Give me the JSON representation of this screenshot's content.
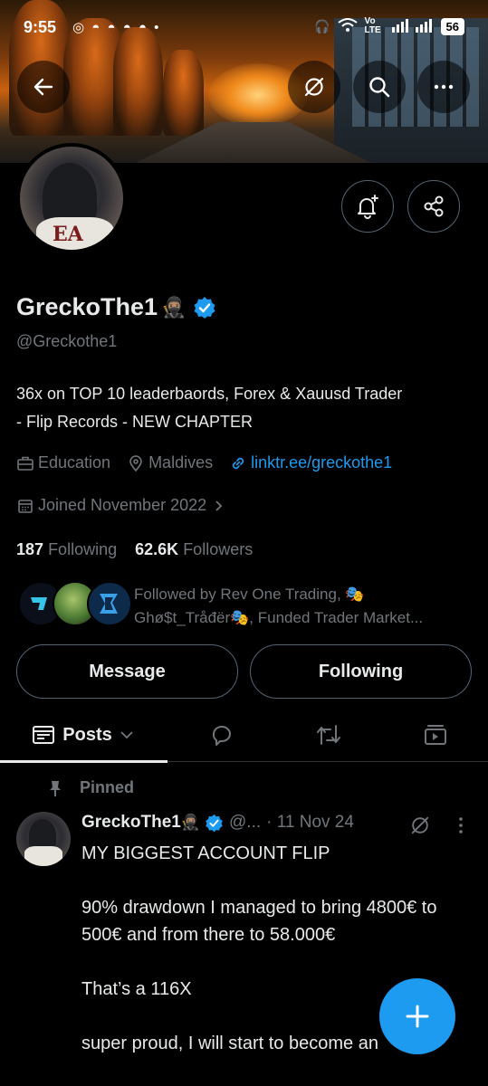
{
  "status_bar": {
    "time": "9:55",
    "network": "Vo LTE",
    "battery": "56"
  },
  "profile": {
    "name": "GreckoThe1",
    "name_emoji": "🥷🏽",
    "handle": "@Greckothe1",
    "bio_line1": "36x on TOP 10 leaderbaords, Forex & Xauusd Trader",
    "bio_line2": "- Flip Records - NEW CHAPTER",
    "category": "Education",
    "location": "Maldives",
    "link": "linktr.ee/greckothe1",
    "joined": "Joined November 2022",
    "following_count": "187",
    "following_label": "Following",
    "followers_count": "62.6K",
    "followers_label": "Followers",
    "followed_by_line1": "Followed by Rev One Trading, 🎭",
    "followed_by_line2": "Ghø$t_Tråđër🎭, Funded Trader Market..."
  },
  "actions": {
    "message": "Message",
    "following": "Following"
  },
  "tabs": {
    "posts": "Posts"
  },
  "pinned_post": {
    "pinned_label": "Pinned",
    "author": "GreckoThe1",
    "author_emoji": "🥷🏽",
    "handle_trunc": "@...",
    "date": "· 11 Nov 24",
    "lines": [
      "MY BIGGEST ACCOUNT FLIP",
      "90% drawdown I managed to bring 4800€  to 500€ and from there to 58.000€",
      "That’s a 116X",
      "super proud, I will start to become an"
    ]
  },
  "colors": {
    "accent": "#1d9bf0",
    "text": "#e7e9ea",
    "muted": "#71767b",
    "border": "#536471",
    "background": "#000000"
  }
}
